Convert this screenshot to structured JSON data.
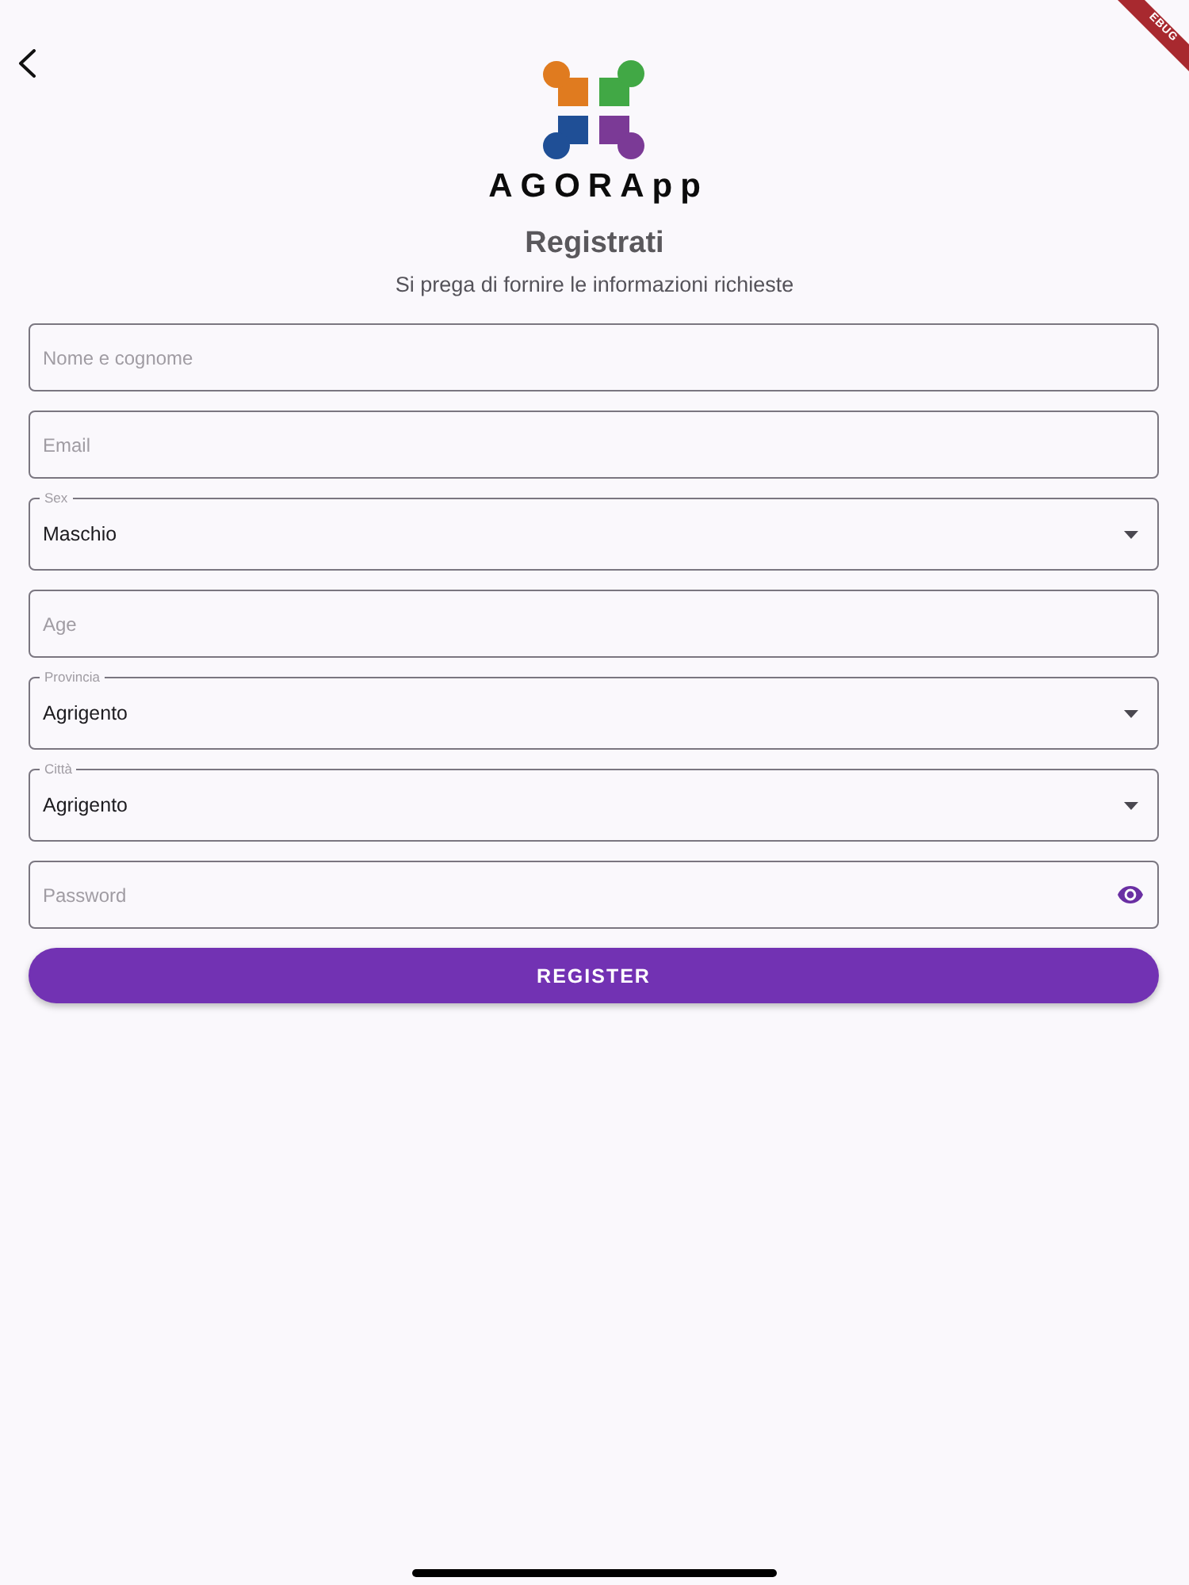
{
  "debug_banner": {
    "text": "EBUG"
  },
  "header": {
    "logo_wordmark": "AGORApp",
    "title": "Registrati",
    "subtitle": "Si prega di fornire le informazioni richieste"
  },
  "form": {
    "fields": [
      {
        "kind": "text",
        "placeholder": "Nome e cognome"
      },
      {
        "kind": "text",
        "placeholder": "Email"
      },
      {
        "kind": "dropdown",
        "label": "Sex",
        "value": "Maschio"
      },
      {
        "kind": "text",
        "placeholder": "Age"
      },
      {
        "kind": "dropdown",
        "label": "Provincia",
        "value": "Agrigento"
      },
      {
        "kind": "dropdown",
        "label": "Città",
        "value": "Agrigento"
      },
      {
        "kind": "password",
        "placeholder": "Password"
      }
    ]
  },
  "register_button": {
    "label": "REGISTER"
  }
}
